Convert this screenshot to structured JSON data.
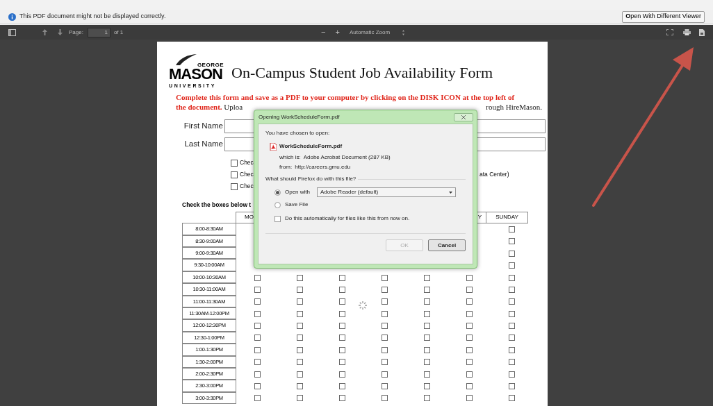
{
  "info_bar": {
    "message": "This PDF document might not be displayed correctly.",
    "button": "**O**pen With Different Viewer"
  },
  "toolbar": {
    "page_label": "Page:",
    "page_value": "1",
    "page_count": "of 1",
    "zoom_out": "−",
    "zoom_in": "+",
    "zoom": "Automatic Zoom"
  },
  "document": {
    "logo": {
      "top": "GEORGE",
      "main": "MASON",
      "bottom": "UNIVERSITY"
    },
    "title": "On-Campus Student Job Availability Form",
    "instruction_lines": [
      {
        "red": "Complete this form and save as a PDF to your computer by clicking on the DISK ICON at the top left of"
      },
      {
        "red": "the document.",
        "plain": "Uploa"
      }
    ],
    "instruction_right": "rough HireMason.",
    "fields": [
      {
        "label": "First Name"
      },
      {
        "label": "Last Name"
      }
    ],
    "options": [
      {
        "label": "Chec",
        "checked": false
      },
      {
        "label": "Chec",
        "trailing": "ata Center)",
        "checked": false
      },
      {
        "label": "Chec",
        "checked": false
      }
    ],
    "schedule_heading": "Check the boxes below t",
    "columns": [
      "MO",
      "Y",
      "SUNDAY"
    ],
    "times": [
      {
        "time": "8:00-8:30AM",
        "checked": [
          false
        ]
      },
      {
        "time": "8:30-9:00AM",
        "checked": [
          false
        ]
      },
      {
        "time": "9:00-9:30AM",
        "checked": [
          false
        ]
      },
      {
        "time": "9:30-10:00AM",
        "checked": [
          false
        ]
      },
      {
        "time": "10:00-10:30AM",
        "checked": [
          false,
          false,
          false,
          false,
          false,
          false,
          false
        ]
      },
      {
        "time": "10:30-11:00AM",
        "checked": [
          false,
          false,
          false,
          false,
          false,
          false,
          false
        ]
      },
      {
        "time": "11:00-11:30AM",
        "checked": [
          false,
          false,
          false,
          false,
          false,
          false,
          false
        ]
      },
      {
        "time": "11:30AM-12:00PM",
        "checked": [
          false,
          false,
          false,
          false,
          false,
          false,
          false
        ]
      },
      {
        "time": "12:00-12:30PM",
        "checked": [
          false,
          false,
          false,
          false,
          false,
          false,
          false
        ]
      },
      {
        "time": "12:30-1:00PM",
        "checked": [
          false,
          false,
          false,
          false,
          false,
          false,
          false
        ]
      },
      {
        "time": "1:00-1:30PM",
        "checked": [
          false,
          false,
          false,
          false,
          false,
          false,
          false
        ]
      },
      {
        "time": "1:30-2:00PM",
        "checked": [
          false,
          false,
          false,
          false,
          false,
          false,
          false
        ]
      },
      {
        "time": "2:00-2:30PM",
        "checked": [
          false,
          false,
          false,
          false,
          false,
          false,
          false
        ]
      },
      {
        "time": "2:30-3:00PM",
        "checked": [
          false,
          false,
          false,
          false,
          false,
          false,
          false
        ]
      },
      {
        "time": "3:00-3:30PM",
        "checked": [
          false,
          false,
          false,
          false,
          false,
          false,
          false
        ]
      }
    ]
  },
  "dialog": {
    "title": "Opening WorkScheduleForm.pdf",
    "intro": "You have chosen to open:",
    "file": "WorkScheduleForm.pdf",
    "which_is_label": "which is:",
    "which_is": "Adobe Acrobat Document (287 KB)",
    "from_label": "from:",
    "from": "http://careers.gmu.edu",
    "question": "What should Firefox do with this file?",
    "choices": [
      {
        "label": "Open with",
        "selected": true
      },
      {
        "label": "Save File",
        "selected": false
      }
    ],
    "app": "Adobe Reader  (default)",
    "auto": {
      "label": "Do this automatically for files like this from now on.",
      "checked": false
    },
    "ok": {
      "label": "OK",
      "disabled": true
    },
    "cancel": "Cancel"
  }
}
